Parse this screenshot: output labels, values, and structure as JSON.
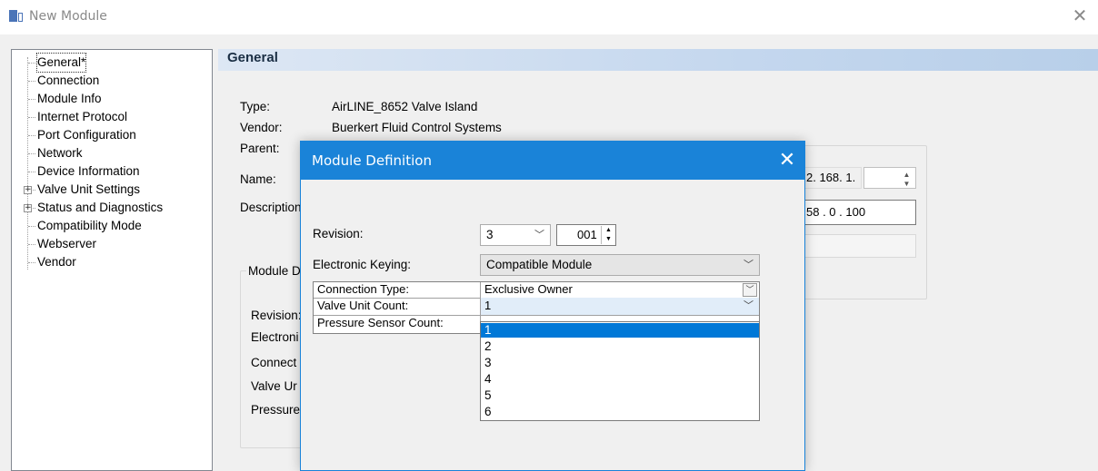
{
  "window": {
    "title": "New Module",
    "close_glyph": "✕"
  },
  "tree": {
    "items": [
      {
        "label": "General*",
        "expandable": false,
        "selected": true
      },
      {
        "label": "Connection",
        "expandable": false
      },
      {
        "label": "Module Info",
        "expandable": false
      },
      {
        "label": "Internet Protocol",
        "expandable": false
      },
      {
        "label": "Port Configuration",
        "expandable": false
      },
      {
        "label": "Network",
        "expandable": false
      },
      {
        "label": "Device Information",
        "expandable": false
      },
      {
        "label": "Valve Unit Settings",
        "expandable": true
      },
      {
        "label": "Status and Diagnostics",
        "expandable": true
      },
      {
        "label": "Compatibility Mode",
        "expandable": false
      },
      {
        "label": "Webserver",
        "expandable": false
      },
      {
        "label": "Vendor",
        "expandable": false
      }
    ]
  },
  "general": {
    "header": "General",
    "type_label": "Type:",
    "type_value": "AirLINE_8652 Valve Island",
    "vendor_label": "Vendor:",
    "vendor_value": "Buerkert Fluid Control Systems",
    "parent_label": "Parent:",
    "name_label": "Name:",
    "description_label": "Description",
    "ip_partial": "2. 168. 1.",
    "ip_address_partial": "58  .  0   .  100",
    "module_def_group_partial": "Module D",
    "bg_revision_label": "Revision:",
    "bg_electronic_label": "Electroni",
    "bg_connect_label": "Connect",
    "bg_valve_label": "Valve Ur",
    "bg_pressure_label": "Pressure"
  },
  "dialog": {
    "title": "Module Definition",
    "close_glyph": "✕",
    "revision_label": "Revision:",
    "revision_major": "3",
    "revision_minor": "001",
    "keying_label": "Electronic Keying:",
    "keying_value": "Compatible Module",
    "grid": [
      {
        "label": "Connection Type:",
        "value": "Exclusive Owner"
      },
      {
        "label": "Valve Unit Count:",
        "value": "1"
      },
      {
        "label": "Pressure Sensor Count:",
        "value": ""
      }
    ],
    "dropdown_options": [
      "1",
      "2",
      "3",
      "4",
      "5",
      "6"
    ],
    "dropdown_selected": "1"
  }
}
